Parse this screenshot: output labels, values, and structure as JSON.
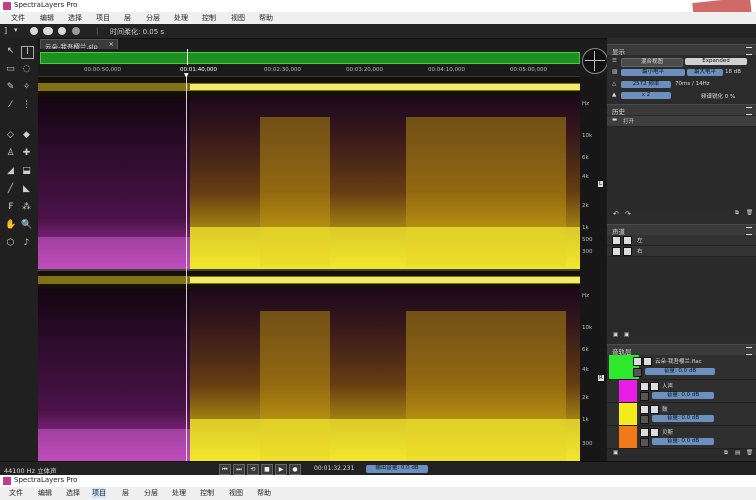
{
  "app": {
    "title": "SpectraLayers Pro"
  },
  "menu": [
    "文件",
    "编辑",
    "选择",
    "项目",
    "层",
    "分层",
    "处理",
    "控制",
    "视图",
    "帮助"
  ],
  "menu2": [
    "文件",
    "编辑",
    "选择",
    "项目",
    "层",
    "分层",
    "处理",
    "控制",
    "视图",
    "帮助"
  ],
  "toolbar": {
    "time_smoothing": "时间柔化: 0.05 s"
  },
  "document": {
    "tab": "云朵-我吾樱兰.slp"
  },
  "ruler": [
    "00:00:50,000",
    "00:01:40,000",
    "00:02:30,000",
    "00:03:20,000",
    "00:04:10,000",
    "00:05:00,000"
  ],
  "freq_labels_top": [
    "Hz",
    "10k",
    "6k",
    "4k",
    "2k",
    "1k",
    "500",
    "300"
  ],
  "freq_labels_bottom": [
    "Hz",
    "10k",
    "6k",
    "4k",
    "2k",
    "1k",
    "300"
  ],
  "channel_markers": [
    "L",
    "R"
  ],
  "display_panel": {
    "title": "显示",
    "mode_button": "混合视图",
    "mode_value": "Expanded",
    "max_level_label": "最大电平",
    "max_level_value": "18 dB",
    "min_level_label": "最小电平",
    "min_level_value": "-92 dB",
    "fft_label": "FFT 大小",
    "fft_value": "2572 频率",
    "resolution": "70ms / 14Hz",
    "speed_label": "采样率",
    "speed_value": "x 2",
    "sharpness": "频谱锐化 0 %"
  },
  "history_panel": {
    "title": "历史",
    "items": [
      "打开"
    ]
  },
  "channel_panel": {
    "title": "声道",
    "items": [
      "左",
      "右"
    ]
  },
  "layers_panel": {
    "title": "音轨层",
    "main_layer": {
      "name": "云朵-我吾樱兰.flac",
      "volume": "音量: 0.0 dB",
      "color": "#2ee82e"
    },
    "layers": [
      {
        "name": "人声",
        "volume": "音量: 0.0 dB",
        "color": "#e81ee8"
      },
      {
        "name": "鼓",
        "volume": "音量: 0.0 dB",
        "color": "#f2ec1a"
      },
      {
        "name": "贝斯",
        "volume": "音量: 0.0 dB",
        "color": "#f07a1a"
      }
    ]
  },
  "status": {
    "format": "44100 Hz 立体声",
    "position": "00:01:32.231",
    "volume": "输出音量: 0.0 dB"
  }
}
